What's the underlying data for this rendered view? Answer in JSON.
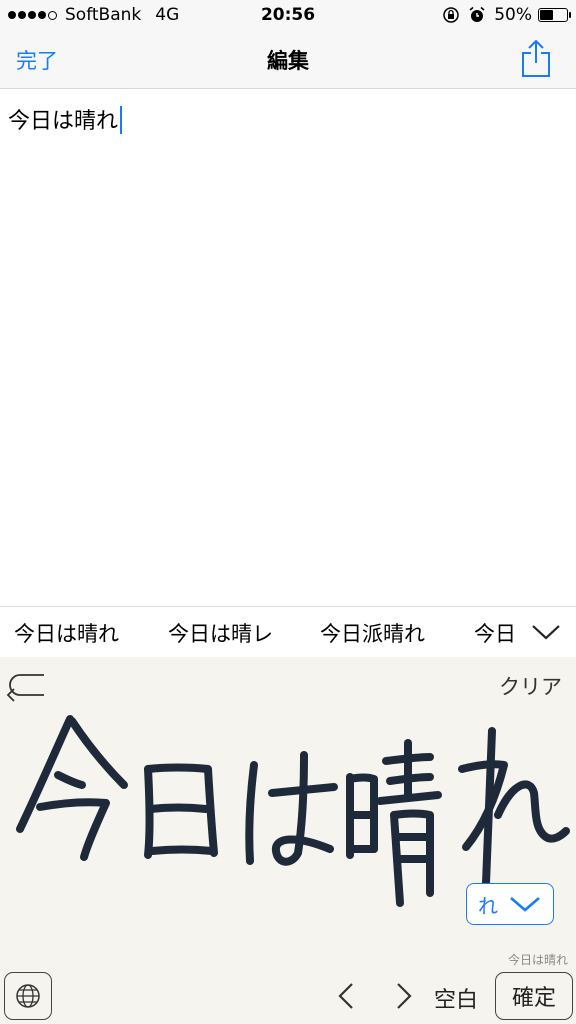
{
  "status_bar": {
    "carrier": "SoftBank",
    "network": "4G",
    "time": "20:56",
    "battery_percent": "50%",
    "battery_level": 0.5,
    "signal_bars_filled": 4,
    "signal_bars_total": 5
  },
  "nav": {
    "done_label": "完了",
    "title": "編集",
    "share_icon": "share-icon"
  },
  "editor": {
    "text": "今日は晴れ"
  },
  "candidates": [
    "今日は晴れ",
    "今日は晴レ",
    "今日派晴れ",
    "今日は"
  ],
  "handwriting": {
    "undo_icon": "undo-icon",
    "clear_label": "クリア",
    "char_choice": "れ",
    "preview": "今日は晴れ",
    "space_label": "空白",
    "confirm_label": "確定",
    "globe_icon": "globe-icon"
  },
  "colors": {
    "accent": "#1a7cf5",
    "ink": "#1e2a3a",
    "pad_background": "#f5f4ee"
  }
}
